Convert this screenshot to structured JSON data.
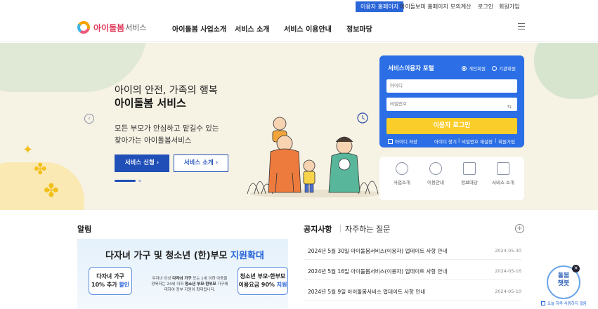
{
  "topbar": {
    "items": [
      "이용자 홈페이지",
      "아이돌보미 홈페이지",
      "모의계산",
      "로그인",
      "회원가입"
    ]
  },
  "header": {
    "logo_main": "아이돌봄",
    "logo_sub": "서비스",
    "nav": [
      "아이돌봄 사업소개",
      "서비스 소개",
      "서비스 이용안내",
      "정보마당"
    ]
  },
  "hero": {
    "title1": "아이의 안전, 가족의 행복",
    "title2": "아이돌봄 서비스",
    "desc1": "모든 부모가 안심하고 맡길수 있는",
    "desc2": "찾아가는 아이돌봄서비스",
    "btn_apply": "서비스 신청 ›",
    "btn_intro": "서비스 소개 ›"
  },
  "login": {
    "title": "서비스이용자 포털",
    "radio_personal": "개인회원",
    "radio_org": "기관회원",
    "id_placeholder": "아이디",
    "pw_placeholder": "비밀번호",
    "btn_login": "이용자 로그인",
    "save_id": "아이디 저장",
    "find_id": "아이디 찾기",
    "reset_pw": "비밀번호 재설정",
    "join": "회원가입"
  },
  "quick_menu": [
    "사업소개",
    "이용안내",
    "정보마당",
    "서비스 소개"
  ],
  "notice_section": {
    "alert_title": "알림",
    "notice_tab": "공지사항",
    "faq_tab": "자주하는 질문",
    "banner_title_a": "다자녀 가구 및 청소년 (한)부모 ",
    "banner_title_b": "지원확대",
    "badge_left_1": "다자녀 가구",
    "badge_left_2a": "10% 추가 ",
    "badge_left_2b": "할인",
    "badge_right_1": "청소년 부모·한부모",
    "badge_right_2a": "이용요금 90% ",
    "badge_right_2b": "지원",
    "banner_mid_1": "두자녀 이상 ",
    "banner_mid_1b": "다자녀 가구",
    "banner_mid_1c": " 또는 1세 이하 아동을",
    "banner_mid_2": "양육하는 24세 이하 ",
    "banner_mid_2b": "청소년 부모·한부모",
    "banner_mid_2c": " 가구에",
    "banner_mid_3": "대하여 정부 지원이 확대됩니다.",
    "notices": [
      {
        "title": "2024년 5월 30일 아이돌봄서비스(이용자) 업데이트 사항 안내",
        "date": "2024-05-30"
      },
      {
        "title": "2024년 5월 16일 아이돌봄서비스(이용자) 업데이트 사항 안내",
        "date": "2024-05-16"
      },
      {
        "title": "2024년 5월 9일 아이돌봄서비스 업데이트 사항 안내",
        "date": "2024-05-10"
      }
    ]
  },
  "chatbot": {
    "line1": "돌봄",
    "line2": "챗봇",
    "option": "오늘 하루 사용하지 않음"
  }
}
